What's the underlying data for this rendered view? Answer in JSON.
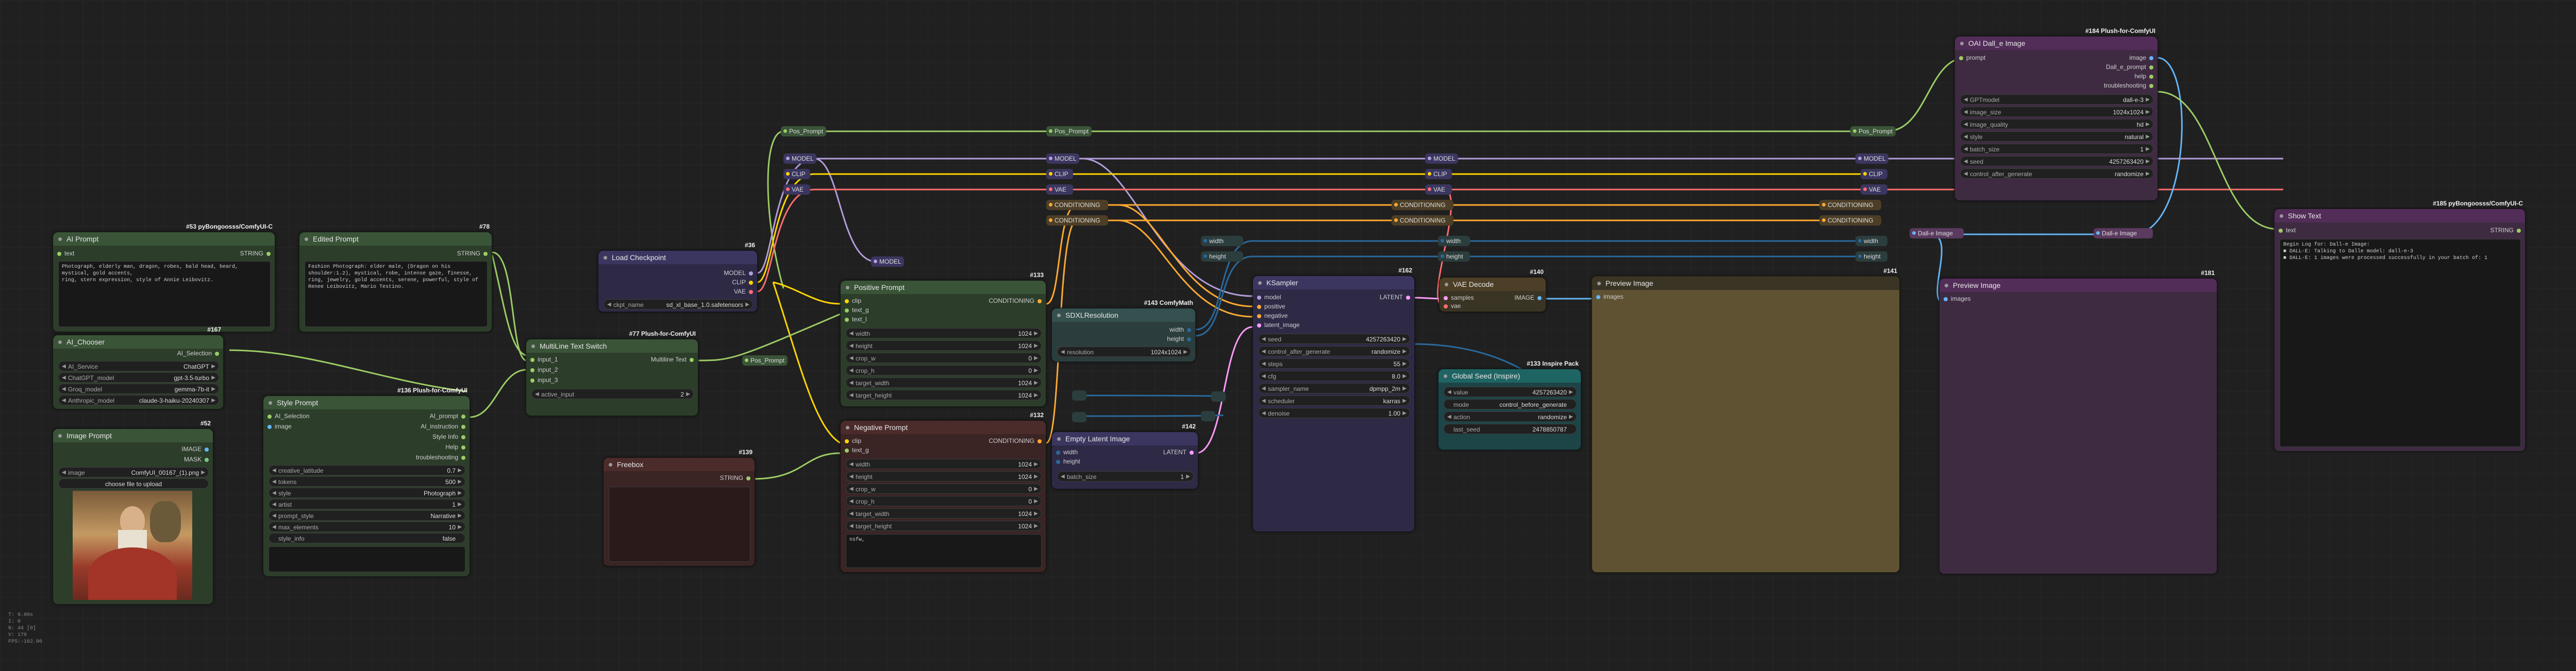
{
  "colors": {
    "model": "#b39ddb",
    "clip": "#ffd500",
    "vae": "#ff6e6e",
    "conditioning": "#ffa931",
    "latent": "#ff9cf9",
    "image": "#64b5f6",
    "string": "#9ccc65",
    "int": "#29699c"
  },
  "nodes": {
    "ai_prompt": {
      "title": "AI Prompt",
      "badge": "#53 pyBongoosss/ComfyUI-C",
      "in_text": "text",
      "out": "STRING"
    },
    "edited_prompt": {
      "title": "Edited Prompt",
      "badge": "#78",
      "out": "STRING",
      "text": "Fashion Photograph: elder male, (Dragon on his shoulder:1.2), mystical, robe, intense gaze, finesse, ring, jewelry, gold accents, serene, powerful, style of Renee Leibovitz, Mario Testino."
    },
    "ai_chooser": {
      "title": "AI_Chooser",
      "badge": "#167",
      "out": "AI_Selection",
      "widgets": [
        {
          "label": "AI_Service",
          "value": "ChatGPT"
        },
        {
          "label": "ChatGPT_model",
          "value": "gpt-3.5-turbo"
        },
        {
          "label": "Groq_model",
          "value": "gemma-7b-it"
        },
        {
          "label": "Anthropic_model",
          "value": "claude-3-haiku-20240307"
        }
      ]
    },
    "image_prompt": {
      "title": "Image Prompt",
      "badge": "#52",
      "outs": [
        "IMAGE",
        "MASK"
      ],
      "widget": {
        "label": "image",
        "value": "ComfyUI_00167_(1).png"
      },
      "upload": "choose file to upload"
    },
    "style_prompt": {
      "title": "Style Prompt",
      "badge": "#136 Plush-for-ComfyUI",
      "ins": [
        "AI_Selection",
        "image"
      ],
      "outs": [
        "AI_prompt",
        "AI_instruction",
        "Style Info",
        "Help",
        "troubleshooting"
      ],
      "widgets": [
        {
          "label": "creative_latitude",
          "value": "0.7"
        },
        {
          "label": "tokens",
          "value": "500"
        },
        {
          "label": "style",
          "value": "Photograph"
        },
        {
          "label": "artist",
          "value": "1"
        },
        {
          "label": "prompt_style",
          "value": "Narrative"
        },
        {
          "label": "max_elements",
          "value": "10"
        },
        {
          "label": "style_info",
          "value": "false"
        }
      ]
    },
    "multiline_switch": {
      "title": "MultiLine Text Switch",
      "badge": "#77 Plush-for-ComfyUI",
      "ins": [
        "input_1",
        "input_2",
        "input_3"
      ],
      "out": "Multiline Text",
      "widget": {
        "label": "active_input",
        "value": "2"
      }
    },
    "load_checkpoint": {
      "title": "Load Checkpoint",
      "badge": "#36",
      "outs": [
        "MODEL",
        "CLIP",
        "VAE"
      ],
      "widget": {
        "label": "ckpt_name",
        "value": "sd_xl_base_1.0.safetensors"
      }
    },
    "freebox": {
      "title": "Freebox",
      "badge": "#139",
      "out": "STRING"
    },
    "positive_prompt": {
      "title": "Positive Prompt",
      "badge": "#133",
      "ins": [
        "clip",
        "text_g",
        "text_l"
      ],
      "out": "CONDITIONING",
      "widgets": [
        {
          "label": "width",
          "value": "1024"
        },
        {
          "label": "height",
          "value": "1024"
        },
        {
          "label": "crop_w",
          "value": "0"
        },
        {
          "label": "crop_h",
          "value": "0"
        },
        {
          "label": "target_width",
          "value": "1024"
        },
        {
          "label": "target_height",
          "value": "1024"
        }
      ]
    },
    "negative_prompt": {
      "title": "Negative Prompt",
      "badge": "#132",
      "ins": [
        "clip",
        "text_g"
      ],
      "out": "CONDITIONING",
      "widgets": [
        {
          "label": "width",
          "value": "1024"
        },
        {
          "label": "height",
          "value": "1024"
        },
        {
          "label": "crop_w",
          "value": "0"
        },
        {
          "label": "crop_h",
          "value": "0"
        },
        {
          "label": "target_width",
          "value": "1024"
        },
        {
          "label": "target_height",
          "value": "1024"
        }
      ],
      "text": "nsfw,"
    },
    "sdxl_resolution": {
      "title": "SDXLResolution",
      "badge": "#143 ComfyMath",
      "outs": [
        "width",
        "height"
      ],
      "widget": {
        "label": "resolution",
        "value": "1024x1024"
      }
    },
    "empty_latent": {
      "title": "Empty Latent Image",
      "badge": "#142",
      "ins": [
        "width",
        "height"
      ],
      "out": "LATENT",
      "widget": {
        "label": "batch_size",
        "value": "1"
      }
    },
    "ksampler": {
      "title": "KSampler",
      "badge": "#162",
      "ins": [
        "model",
        "positive",
        "negative",
        "latent_image"
      ],
      "out": "LATENT",
      "widgets": [
        {
          "label": "seed",
          "value": "4257263420"
        },
        {
          "label": "control_after_generate",
          "value": "randomize"
        },
        {
          "label": "steps",
          "value": "55"
        },
        {
          "label": "cfg",
          "value": "8.0"
        },
        {
          "label": "sampler_name",
          "value": "dpmpp_2m"
        },
        {
          "label": "scheduler",
          "value": "karras"
        },
        {
          "label": "denoise",
          "value": "1.00"
        }
      ]
    },
    "vae_decode": {
      "title": "VAE Decode",
      "badge": "#140",
      "ins": [
        "samples",
        "vae"
      ],
      "out": "IMAGE"
    },
    "global_seed": {
      "title": "Global Seed (Inspire)",
      "badge": "#133 Inspire Pack",
      "widgets": [
        {
          "label": "value",
          "value": "4257263420"
        },
        {
          "label": "mode",
          "value": "control_before_generate"
        },
        {
          "label": "action",
          "value": "randomize"
        },
        {
          "label": "last_seed",
          "value": "2478850787"
        }
      ]
    },
    "preview_image_1": {
      "title": "Preview Image",
      "badge": "#141",
      "in": "images"
    },
    "dalle": {
      "title": "OAI Dall_e Image",
      "badge": "#184 Plush-for-ComfyUI",
      "in": "prompt",
      "outs": [
        "image",
        "Dall_e_prompt",
        "help",
        "troubleshooting"
      ],
      "widgets": [
        {
          "label": "GPTmodel",
          "value": "dall-e-3"
        },
        {
          "label": "image_size",
          "value": "1024x1024"
        },
        {
          "label": "image_quality",
          "value": "hd"
        },
        {
          "label": "style",
          "value": "natural"
        },
        {
          "label": "batch_size",
          "value": "1"
        },
        {
          "label": "seed",
          "value": "4257263420"
        },
        {
          "label": "control_after_generate",
          "value": "randomize"
        }
      ]
    },
    "preview_image_2": {
      "title": "Preview Image",
      "badge": "#181",
      "in": "images"
    },
    "show_text": {
      "title": "Show Text",
      "badge": "#185 pyBongoosss/ComfyUI-C",
      "in": "text",
      "out": "STRING",
      "text": "Begin Log for: Dall-e Image:\n■ DALL-E: Talking to Dalle model: dall-e-3\n■ DALL-E: 1 images were processed successfully in your batch of: 1"
    }
  },
  "reroutes": {
    "pos_prompt": "Pos_Prompt",
    "model": "MODEL",
    "clip": "CLIP",
    "vae": "VAE",
    "conditioning": "CONDITIONING",
    "width": "width",
    "height": "height",
    "dalle_image": "Dall-e Image"
  },
  "stats": [
    "T: 0.00s",
    "I: 0",
    "N: 44 [0]",
    "V: 170",
    "FPS:-162.00"
  ]
}
